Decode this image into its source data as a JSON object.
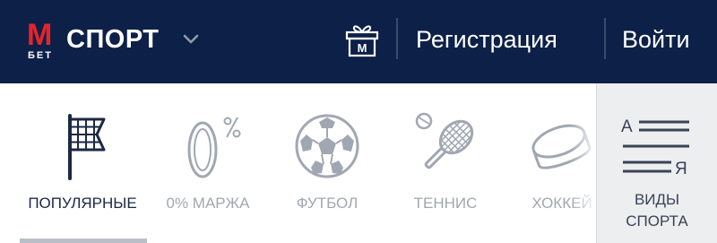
{
  "header": {
    "logo": {
      "mark": "M",
      "sub": "БЕТ",
      "name": "СПОРТ"
    },
    "gift_letter": "M",
    "register_label": "Регистрация",
    "login_label": "Войти"
  },
  "sports": {
    "items": [
      {
        "label": "ПОПУЛЯРНЫЕ",
        "icon": "flag-icon",
        "active": true
      },
      {
        "label": "0% МАРЖА",
        "icon": "zero-percent-icon",
        "active": false
      },
      {
        "label": "ФУТБОЛ",
        "icon": "soccer-ball-icon",
        "active": false
      },
      {
        "label": "ТЕННИС",
        "icon": "tennis-racket-icon",
        "active": false
      },
      {
        "label": "ХОККЕЙ",
        "icon": "hockey-puck-icon",
        "active": false
      }
    ],
    "all_sports": {
      "line1": "ВИДЫ",
      "line2": "СПОРТА",
      "icon_letter_top": "А",
      "icon_letter_bottom": "Я"
    }
  },
  "colors": {
    "header_bg": "#0d2048",
    "logo_red": "#e5252a",
    "active_text": "#1b2845",
    "inactive_icon": "#a1a7b2",
    "panel_bg": "#eceef0"
  }
}
